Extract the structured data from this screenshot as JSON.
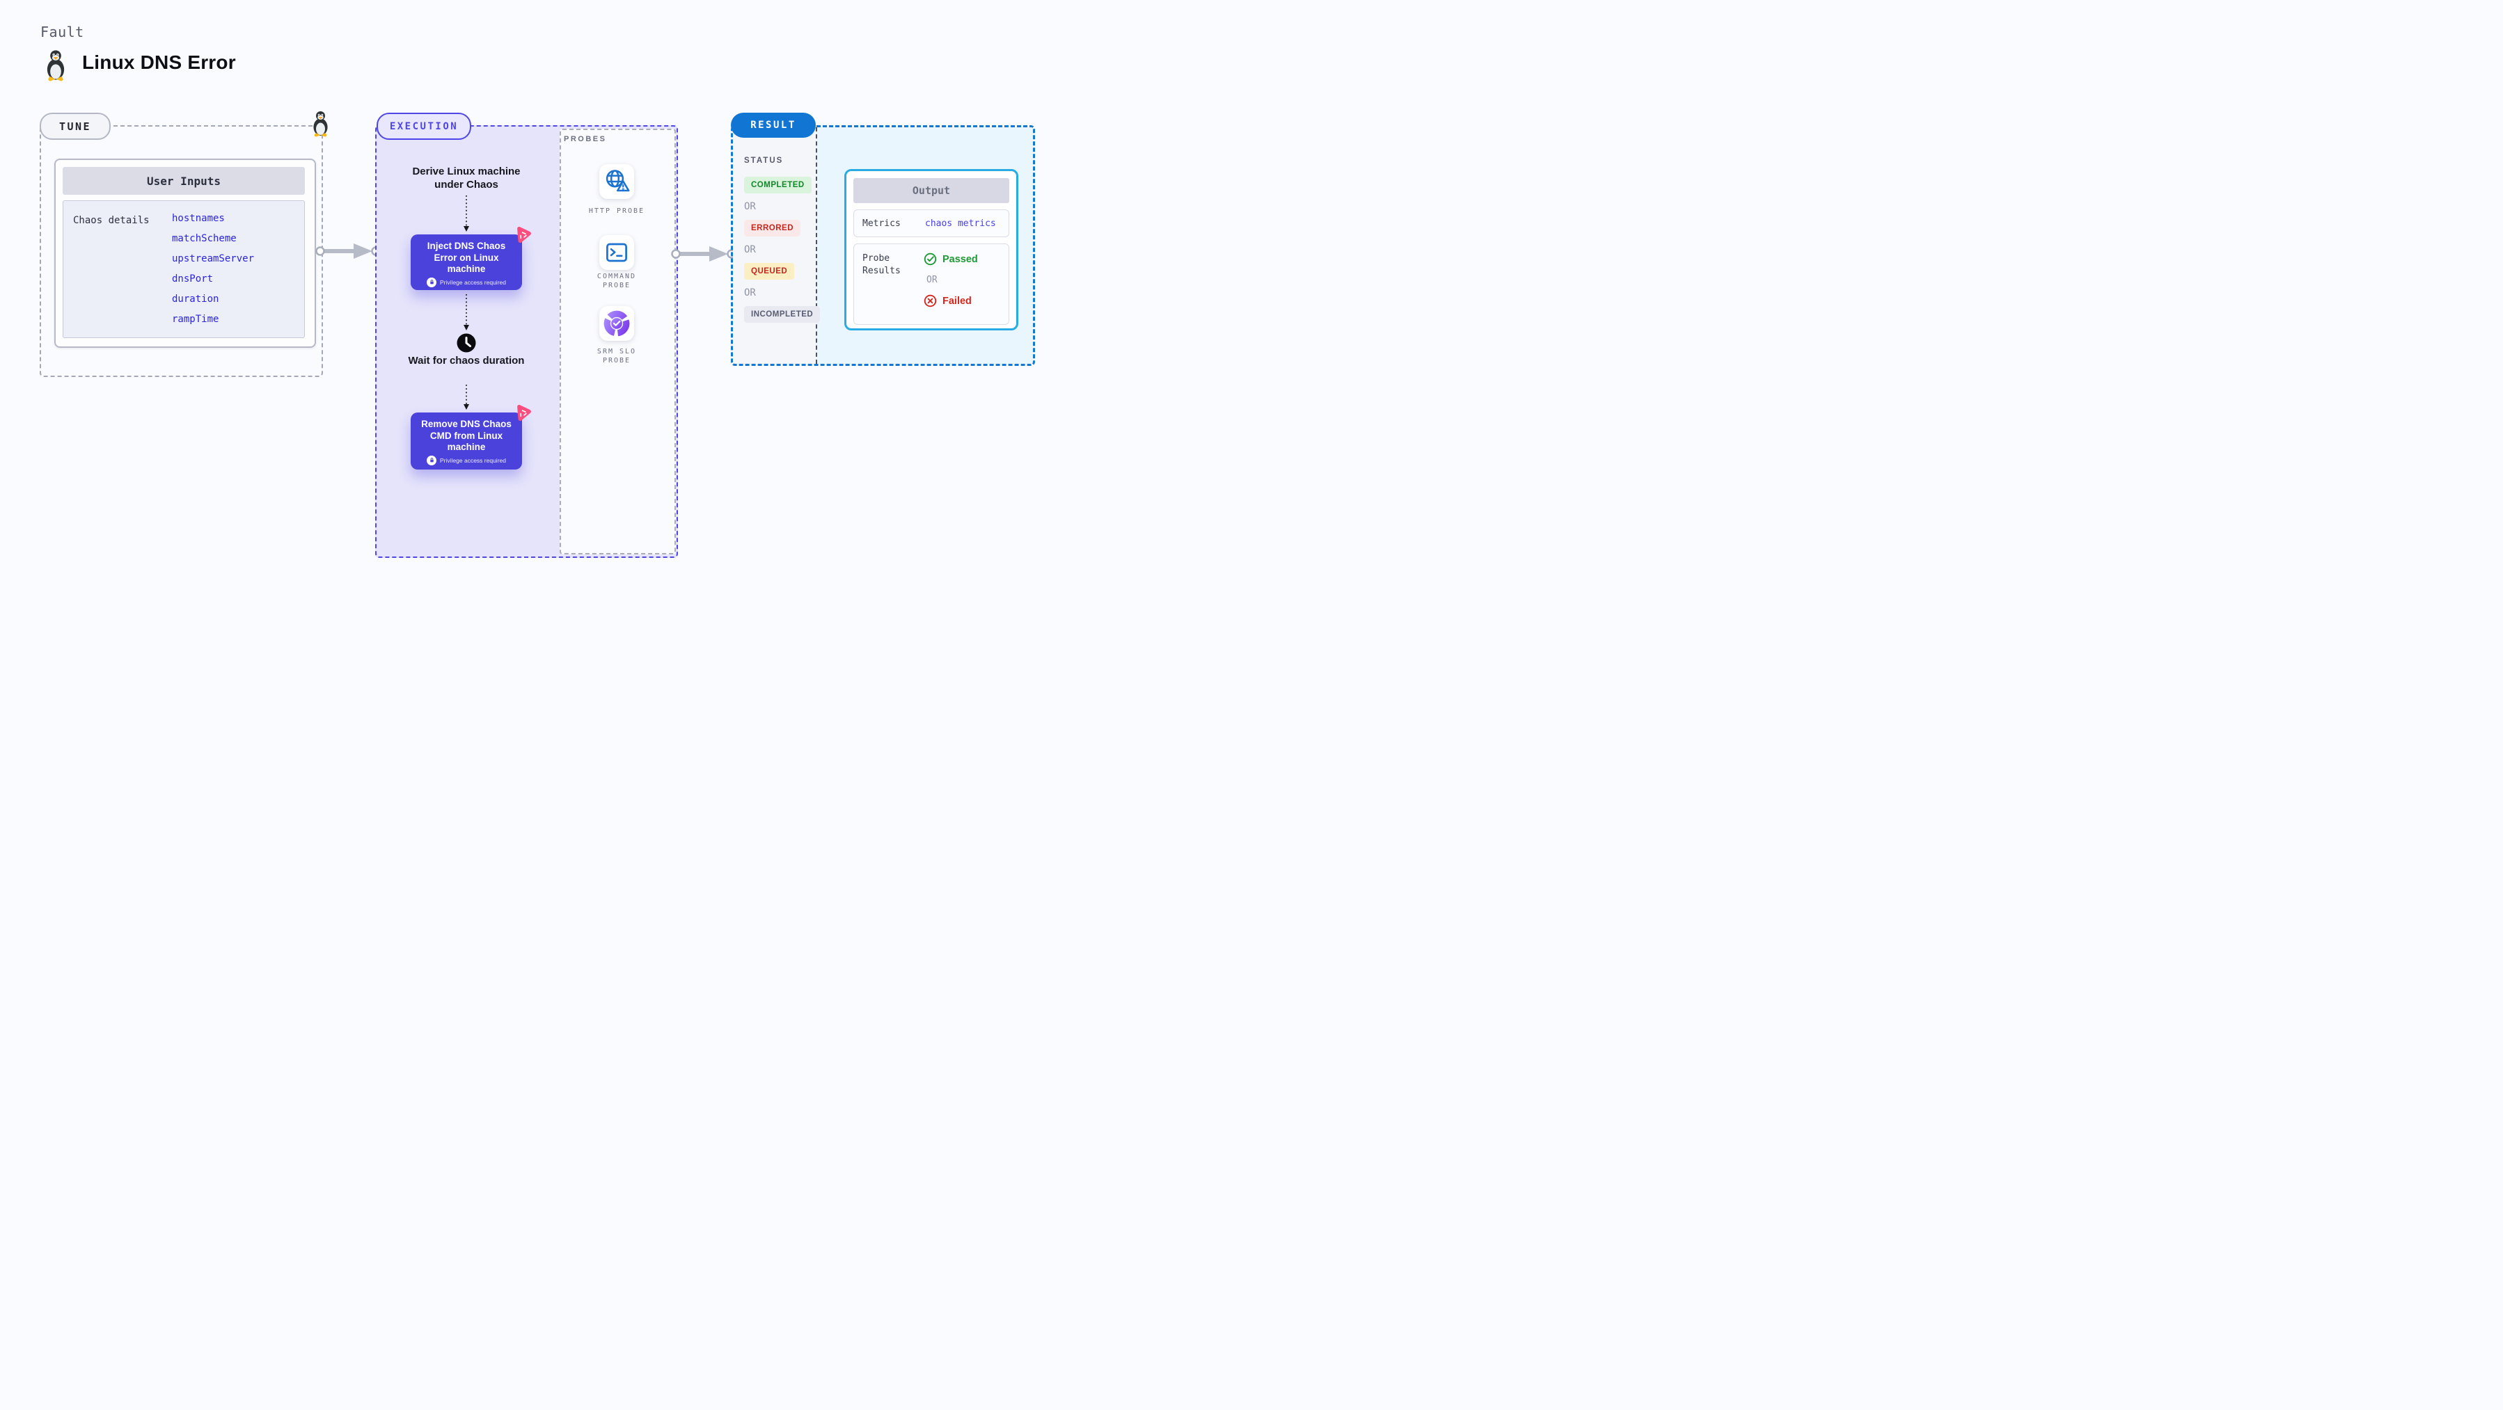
{
  "header": {
    "kicker": "Fault",
    "title": "Linux DNS Error"
  },
  "tune": {
    "label": "TUNE",
    "card_title": "User Inputs",
    "row_label": "Chaos details",
    "params": [
      "hostnames",
      "matchScheme",
      "upstreamServer",
      "dnsPort",
      "duration",
      "rampTime"
    ]
  },
  "execution": {
    "label": "EXECUTION",
    "steps": {
      "derive": "Derive Linux machine under Chaos",
      "inject": "Inject DNS Chaos Error on Linux machine",
      "wait": "Wait for chaos duration",
      "remove": "Remove DNS Chaos CMD from Linux machine"
    },
    "privilege_note": "Privilege access required"
  },
  "probes": {
    "label": "PROBES",
    "items": [
      {
        "name": "HTTP PROBE",
        "icon": "globe-alert-icon"
      },
      {
        "name": "COMMAND PROBE",
        "icon": "terminal-icon"
      },
      {
        "name": "SRM SLO PROBE",
        "icon": "slo-donut-icon"
      }
    ]
  },
  "result": {
    "label": "RESULT",
    "status_label": "STATUS",
    "or_label": "OR",
    "statuses": [
      {
        "label": "COMPLETED",
        "style": "background:#d9f3dc;color:#13862a"
      },
      {
        "label": "ERRORED",
        "style": "background:#fbe9e9;color:#c3271e"
      },
      {
        "label": "QUEUED",
        "style": "background:#fcefc4;color:#c3271e"
      },
      {
        "label": "INCOMPLETED",
        "style": "background:#e9eaf1;color:#575c72"
      }
    ],
    "output": {
      "title": "Output",
      "metrics_label": "Metrics",
      "metrics_value": "chaos metrics",
      "probe_results_label": "Probe Results",
      "passed": "Passed",
      "or_label": "OR",
      "failed": "Failed"
    }
  },
  "colors": {
    "page_bg": "#fafbfe",
    "tune_dash": "#a3a8b5",
    "execution_accent": "#4f46e5",
    "execution_bg": "#e5e4fb",
    "node_purple": "#4a42da",
    "chaos_pink": "#fb4d7e",
    "result_accent": "#1478d0",
    "result_bg": "#e9f6fd",
    "output_border": "#29abe3",
    "probe_icon_blue": "#1b72cf",
    "srm_purple": "#7c3aed",
    "param_blue": "#2a24df",
    "passed_green": "#1d9a33",
    "failed_red": "#d4271d",
    "arrow_gray": "#b7bbc8"
  }
}
